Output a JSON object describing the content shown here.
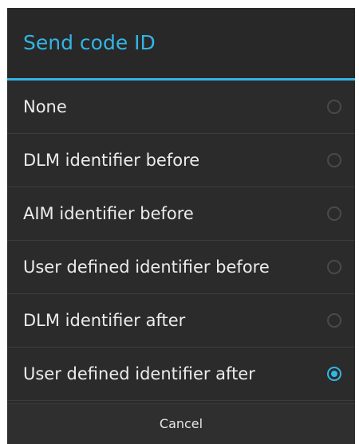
{
  "dialog": {
    "title": "Send code ID",
    "options": [
      {
        "label": "None",
        "selected": false
      },
      {
        "label": "DLM identifier before",
        "selected": false
      },
      {
        "label": "AIM identifier before",
        "selected": false
      },
      {
        "label": "User defined identifier before",
        "selected": false
      },
      {
        "label": "DLM identifier after",
        "selected": false
      },
      {
        "label": "User defined identifier after",
        "selected": true
      }
    ],
    "cancel_label": "Cancel"
  },
  "colors": {
    "accent": "#33b5e5",
    "background": "#2b2b2b",
    "text": "#ececec"
  }
}
